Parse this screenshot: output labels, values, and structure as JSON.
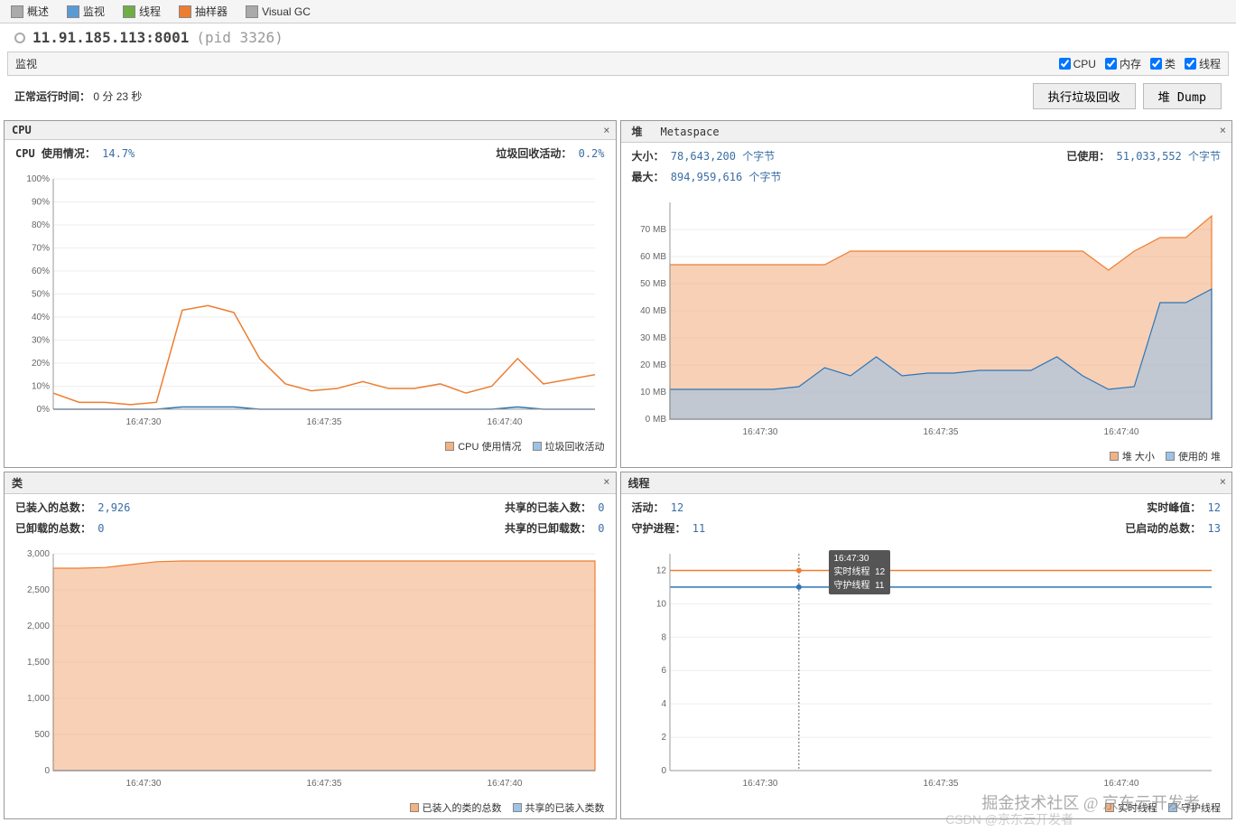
{
  "tabs": [
    "概述",
    "监视",
    "线程",
    "抽样器",
    "Visual GC"
  ],
  "address": "11.91.185.113:8001",
  "pid": "(pid 3326)",
  "monitor_label": "监视",
  "checks": {
    "cpu": "CPU",
    "mem": "内存",
    "class": "类",
    "thread": "线程"
  },
  "uptime": {
    "label": "正常运行时间：",
    "value": "0 分 23 秒"
  },
  "buttons": {
    "gc": "执行垃圾回收",
    "dump": "堆 Dump"
  },
  "panels": {
    "cpu": {
      "title": "CPU",
      "stats": [
        {
          "label": "CPU 使用情况：",
          "value": "14.7%"
        },
        {
          "label": "垃圾回收活动：",
          "value": "0.2%"
        }
      ],
      "legend": [
        "CPU 使用情况",
        "垃圾回收活动"
      ]
    },
    "heap": {
      "tabs": [
        "堆",
        "Metaspace"
      ],
      "stats": [
        {
          "label": "大小：",
          "value": "78,643,200 个字节"
        },
        {
          "label": "已使用：",
          "value": "51,033,552 个字节"
        },
        {
          "label": "最大：",
          "value": "894,959,616 个字节"
        }
      ],
      "legend": [
        "堆 大小",
        "使用的 堆"
      ]
    },
    "classes": {
      "title": "类",
      "stats": [
        {
          "label": "已装入的总数：",
          "value": "2,926"
        },
        {
          "label": "共享的已装入数：",
          "value": "0"
        },
        {
          "label": "已卸载的总数：",
          "value": "0"
        },
        {
          "label": "共享的已卸载数：",
          "value": "0"
        }
      ],
      "legend": [
        "已装入的类的总数",
        "共享的已装入类数"
      ]
    },
    "threads": {
      "title": "线程",
      "stats": [
        {
          "label": "活动：",
          "value": "12"
        },
        {
          "label": "守护进程：",
          "value": "11"
        },
        {
          "label": "实时峰值：",
          "value": "12"
        },
        {
          "label": "已启动的总数：",
          "value": "13"
        }
      ],
      "legend": [
        "实时线程",
        "守护线程"
      ],
      "tooltip": {
        "time": "16:47:30",
        "live_label": "实时线程",
        "live": "12",
        "daemon_label": "守护线程",
        "daemon": "11"
      }
    }
  },
  "watermark": "掘金技术社区 @ 京东云开发者",
  "watermark2": "CSDN @京东云开发者",
  "chart_data": [
    {
      "type": "line",
      "title": "CPU",
      "xlabel": "",
      "ylabel": "%",
      "ylim": [
        0,
        100
      ],
      "x_ticks": [
        "16:47:30",
        "16:47:35",
        "16:47:40"
      ],
      "series": [
        {
          "name": "CPU 使用情况",
          "values": [
            7,
            3,
            3,
            2,
            3,
            43,
            45,
            42,
            22,
            11,
            8,
            9,
            12,
            9,
            9,
            11,
            7,
            10,
            22,
            11,
            13,
            15
          ]
        },
        {
          "name": "垃圾回收活动",
          "values": [
            0,
            0,
            0,
            0,
            0,
            1,
            1,
            1,
            0,
            0,
            0,
            0,
            0,
            0,
            0,
            0,
            0,
            0,
            1,
            0,
            0,
            0
          ]
        }
      ]
    },
    {
      "type": "area",
      "title": "堆",
      "xlabel": "",
      "ylabel": "MB",
      "ylim": [
        0,
        80
      ],
      "x_ticks": [
        "16:47:30",
        "16:47:35",
        "16:47:40"
      ],
      "series": [
        {
          "name": "堆 大小",
          "values": [
            57,
            57,
            57,
            57,
            57,
            57,
            57,
            62,
            62,
            62,
            62,
            62,
            62,
            62,
            62,
            62,
            62,
            55,
            62,
            67,
            67,
            75
          ]
        },
        {
          "name": "使用的 堆",
          "values": [
            11,
            11,
            11,
            11,
            11,
            12,
            19,
            16,
            23,
            16,
            17,
            17,
            18,
            18,
            18,
            23,
            16,
            11,
            12,
            43,
            43,
            48
          ]
        }
      ]
    },
    {
      "type": "area",
      "title": "类",
      "xlabel": "",
      "ylabel": "",
      "ylim": [
        0,
        3000
      ],
      "x_ticks": [
        "16:47:30",
        "16:47:35",
        "16:47:40"
      ],
      "series": [
        {
          "name": "已装入的类的总数",
          "values": [
            2800,
            2800,
            2810,
            2850,
            2890,
            2900,
            2900,
            2900,
            2900,
            2900,
            2900,
            2900,
            2900,
            2900,
            2900,
            2900,
            2900,
            2900,
            2900,
            2900,
            2900,
            2900
          ]
        },
        {
          "name": "共享的已装入类数",
          "values": [
            0,
            0,
            0,
            0,
            0,
            0,
            0,
            0,
            0,
            0,
            0,
            0,
            0,
            0,
            0,
            0,
            0,
            0,
            0,
            0,
            0,
            0
          ]
        }
      ]
    },
    {
      "type": "line",
      "title": "线程",
      "xlabel": "",
      "ylabel": "",
      "ylim": [
        0,
        13
      ],
      "x_ticks": [
        "16:47:30",
        "16:47:35",
        "16:47:40"
      ],
      "series": [
        {
          "name": "实时线程",
          "values": [
            12,
            12,
            12,
            12,
            12,
            12,
            12,
            12,
            12,
            12,
            12,
            12,
            12,
            12,
            12,
            12,
            12,
            12,
            12,
            12,
            12,
            12
          ]
        },
        {
          "name": "守护线程",
          "values": [
            11,
            11,
            11,
            11,
            11,
            11,
            11,
            11,
            11,
            11,
            11,
            11,
            11,
            11,
            11,
            11,
            11,
            11,
            11,
            11,
            11,
            11
          ]
        }
      ]
    }
  ]
}
